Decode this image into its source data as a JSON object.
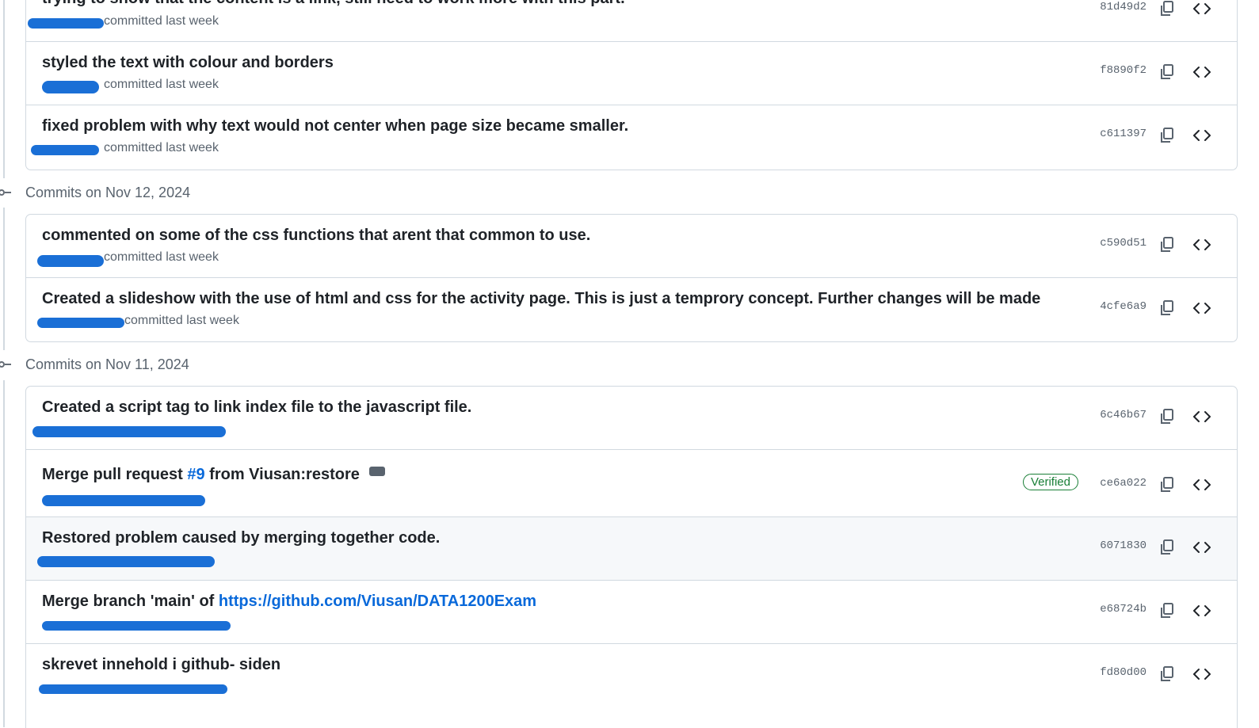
{
  "colors": {
    "link": "#0969da",
    "verified": "#1a7f37",
    "redaction": "#1a6fd6",
    "muted": "#59636e"
  },
  "groups": [
    {
      "header": ""
    },
    {
      "header": "Commits on Nov 12, 2024"
    },
    {
      "header": "Commits on Nov 11, 2024"
    }
  ],
  "commits": [
    {
      "title": "trying to show that the content is a link, still need to work more with this part.",
      "meta": "committed last week",
      "sha": "81d49d2"
    },
    {
      "title": "styled the text with colour and borders",
      "meta": "committed last week",
      "sha": "f8890f2"
    },
    {
      "title": "fixed problem with why text would not center when page size became smaller.",
      "meta": "committed last week",
      "sha": "c611397"
    },
    {
      "title": "commented on some of the css functions that arent that common to use.",
      "meta": "committed last week",
      "sha": "c590d51"
    },
    {
      "title": "Created a slideshow with the use of html and css for the activity page. This is just a temprory concept. Further changes will be made",
      "meta": "committed last week",
      "sha": "4cfe6a9"
    },
    {
      "title": "Created a script tag to link index file to the javascript file.",
      "sha": "6c46b67"
    },
    {
      "title_prefix": "Merge pull request ",
      "title_link": "#9",
      "title_suffix": " from Viusan:restore",
      "badge": "Verified",
      "sha": "ce6a022"
    },
    {
      "title": "Restored problem caused by merging together code.",
      "sha": "6071830"
    },
    {
      "title_prefix": "Merge branch 'main' of ",
      "title_link": "https://github.com/Viusan/DATA1200Exam",
      "sha": "e68724b"
    },
    {
      "title": "skrevet innehold i github- siden",
      "sha": "fd80d00"
    }
  ]
}
